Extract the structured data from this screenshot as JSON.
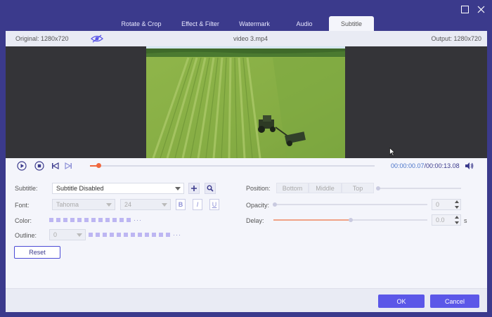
{
  "window": {
    "maximize_icon": "maximize-icon",
    "close_icon": "close-icon"
  },
  "tabs": [
    {
      "label": "Rotate & Crop"
    },
    {
      "label": "Effect & Filter"
    },
    {
      "label": "Watermark"
    },
    {
      "label": "Audio"
    },
    {
      "label": "Subtitle",
      "active": true
    }
  ],
  "info_bar": {
    "original": "Original: 1280x720",
    "filename": "video 3.mp4",
    "output": "Output: 1280x720"
  },
  "player": {
    "current_time": "00:00:00.07",
    "total_time": "/00:00:13.08",
    "progress": 0.03
  },
  "subtitle": {
    "label": "Subtitle:",
    "value": "Subtitle Disabled"
  },
  "font": {
    "label": "Font:",
    "family": "Tahoma",
    "size": "24",
    "bold": "B",
    "italic": "I",
    "underline": "U"
  },
  "color": {
    "label": "Color:",
    "more": "···"
  },
  "outline": {
    "label": "Outline:",
    "value": "0",
    "more": "···"
  },
  "reset_label": "Reset",
  "position": {
    "label": "Position:",
    "options": [
      "Bottom",
      "Middle",
      "Top"
    ]
  },
  "opacity": {
    "label": "Opacity:",
    "value": "0"
  },
  "delay": {
    "label": "Delay:",
    "value": "0.0",
    "unit": "s",
    "level": 0.5
  },
  "footer": {
    "ok": "OK",
    "cancel": "Cancel"
  },
  "colors": {
    "accent": "#5b57e8",
    "frame": "#3b3a8c",
    "progress": "#f0673d"
  }
}
